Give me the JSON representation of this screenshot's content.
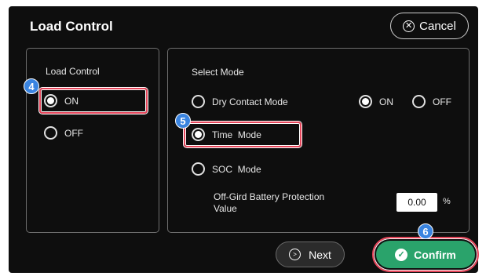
{
  "header": {
    "title": "Load Control",
    "cancel_label": "Cancel"
  },
  "left_panel": {
    "heading": "Load Control",
    "options": [
      {
        "label": "ON",
        "selected": true
      },
      {
        "label": "OFF",
        "selected": false
      }
    ]
  },
  "right_panel": {
    "heading": "Select Mode",
    "modes": [
      {
        "label": "Dry Contact Mode",
        "selected": false
      },
      {
        "label": "Time  Mode",
        "selected": true
      },
      {
        "label": "SOC  Mode",
        "selected": false
      }
    ],
    "dry_contact_toggle": [
      {
        "label": "ON",
        "selected": true
      },
      {
        "label": "OFF",
        "selected": false
      }
    ],
    "protection_label_line1": "Off-Gird Battery Protection",
    "protection_label_line2": "Value",
    "protection_value": "0.00",
    "protection_unit": "%"
  },
  "footer": {
    "next_label": "Next",
    "confirm_label": "Confirm"
  },
  "step_badges": {
    "step4": "4",
    "step5": "5",
    "step6": "6"
  },
  "colors": {
    "highlight": "#e5455a",
    "badge": "#3a84e0",
    "confirm": "#2aa36b",
    "background": "#0e0e0e"
  },
  "icons": {
    "cancel": "x-circle-icon",
    "next": "arrow-right-circle-icon",
    "confirm": "check-circle-icon"
  }
}
